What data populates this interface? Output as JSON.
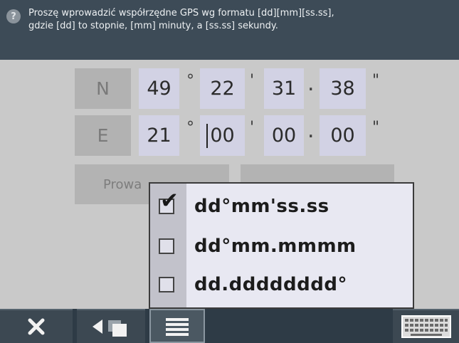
{
  "header": {
    "help_icon": "?",
    "instruction_line1": "Proszę wprowadzić współrzędne GPS wg formatu [dd][mm][ss.ss],",
    "instruction_line2": "gdzie [dd] to stopnie, [mm] minuty, a [ss.ss] sekundy."
  },
  "latitude": {
    "hemisphere": "N",
    "degrees": "49",
    "minutes": "22",
    "seconds": "31",
    "hundredths": "38"
  },
  "longitude": {
    "hemisphere": "E",
    "degrees": "21",
    "minutes": "00",
    "seconds": "00",
    "hundredths": "00"
  },
  "symbols": {
    "degree": "°",
    "minute": "'",
    "decimal": ".",
    "second": "\""
  },
  "buttons": {
    "left_partial": "Prowa"
  },
  "format_menu": {
    "options": [
      {
        "label": "dd°mm'ss.ss",
        "checked": true
      },
      {
        "label": "dd°mm.mmmm",
        "checked": false
      },
      {
        "label": "dd.dddddddd°",
        "checked": false
      }
    ],
    "check_glyph": "✔"
  },
  "toolbar": {
    "close_icon": "close-icon",
    "back_icon": "back-icon",
    "list_icon": "list-icon",
    "keyboard_icon": "keyboard-icon"
  },
  "colors": {
    "header_bg": "#3d4b57",
    "field_bg": "#d2d2e4",
    "label_bg": "#b2b2b2",
    "toolbar_bg": "#2e3b46"
  }
}
